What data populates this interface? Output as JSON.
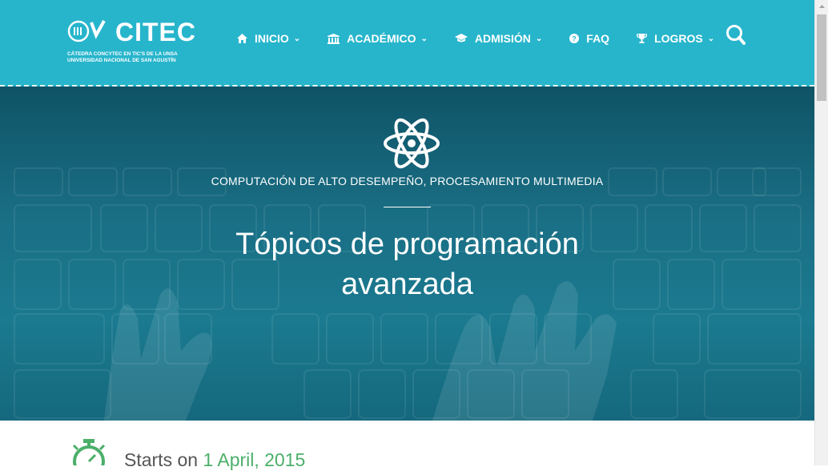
{
  "brand": {
    "name": "CITEC",
    "subtitle_line1": "CÁTEDRA CONCYTEC EN TIC'S DE LA UNSA",
    "subtitle_line2": "UNIVERSIDAD NACIONAL DE SAN AGUSTÍN"
  },
  "nav": {
    "items": [
      {
        "label": "INICIO",
        "icon": "home-icon",
        "dropdown": true
      },
      {
        "label": "ACADÉMICO",
        "icon": "institution-icon",
        "dropdown": true
      },
      {
        "label": "ADMISIÓN",
        "icon": "graduation-cap-icon",
        "dropdown": true
      },
      {
        "label": "FAQ",
        "icon": "question-circle-icon",
        "dropdown": false
      },
      {
        "label": "LOGROS",
        "icon": "trophy-icon",
        "dropdown": true
      }
    ],
    "search_icon": "search-icon"
  },
  "hero": {
    "icon": "atom-icon",
    "category": "COMPUTACIÓN DE ALTO DESEMPEÑO, PROCESAMIENTO MULTIMEDIA",
    "title_line1": "Tópicos de programación",
    "title_line2": "avanzada"
  },
  "course": {
    "starts_label": "Starts on",
    "start_date": "1 April, 2015",
    "icon": "stopwatch-icon"
  },
  "colors": {
    "nav_bg": "#27b5cc",
    "accent_green": "#4caf6a"
  }
}
